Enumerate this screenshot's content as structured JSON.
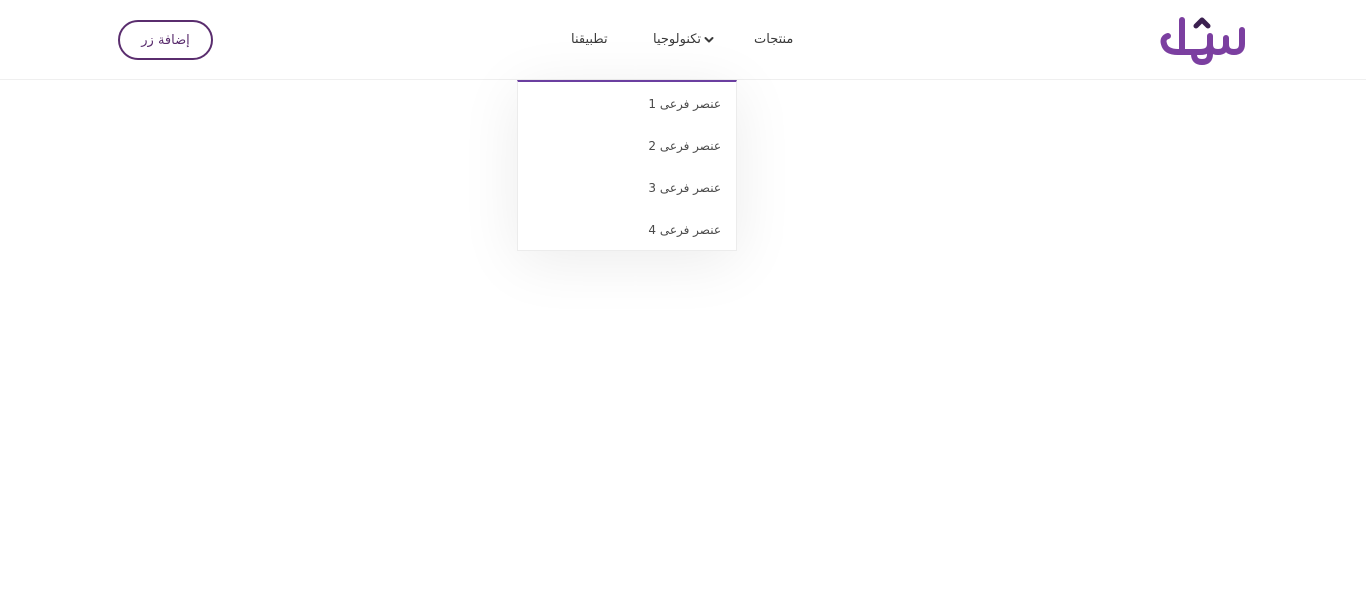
{
  "header": {
    "logo_text": "سهل",
    "nav": {
      "products": "منتجات",
      "technology": "تكنولوجيا",
      "apps": "تطبيقنا"
    },
    "cta_label": "إضافة زر"
  },
  "dropdown": {
    "items": [
      {
        "label": "عنصر فرعى 1"
      },
      {
        "label": "عنصر فرعى 2"
      },
      {
        "label": "عنصر فرعى 3"
      },
      {
        "label": "عنصر فرعى 4"
      }
    ]
  },
  "colors": {
    "brand": "#7b3fa0",
    "button_border": "#5a2d6e",
    "dropdown_accent": "#6b3fa0"
  },
  "icons": {
    "logo": "sahl-logo",
    "dropdown_toggle": "chevron-down-icon"
  }
}
